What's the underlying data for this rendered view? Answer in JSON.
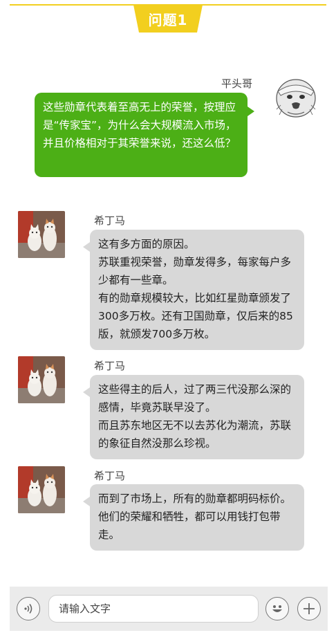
{
  "header": {
    "title": "问题1",
    "accent_color": "#f2cf1f"
  },
  "messages": [
    {
      "side": "right",
      "author": "平头哥",
      "avatar_icon": "honey-badger-avatar-icon",
      "lines": [
        "这些勋章代表着至高无上的荣誉，按理应是“传家宝”，为什么会大规模流入市场，并且价格相对于其荣誉来说，还这么低？"
      ],
      "bubble_color": "#4caf16"
    },
    {
      "side": "left",
      "author": "希丁马",
      "avatar_icon": "cats-avatar-icon",
      "lines": [
        "这有多方面的原因。",
        "苏联重视荣誉，勋章发得多，每家每户多少都有一些章。",
        "有的勋章规模较大，比如红星勋章颁发了300多万枚。还有卫国勋章，仅后来的85版，就颁发700多万枚。"
      ],
      "bubble_color": "#d8d8d8"
    },
    {
      "side": "left",
      "author": "希丁马",
      "avatar_icon": "cats-avatar-icon",
      "lines": [
        "这些得主的后人，过了两三代没那么深的感情，毕竟苏联早没了。",
        "而且苏东地区无不以去苏化为潮流，苏联的象征自然没那么珍视。"
      ],
      "bubble_color": "#d8d8d8"
    },
    {
      "side": "left",
      "author": "希丁马",
      "avatar_icon": "cats-avatar-icon",
      "lines": [
        "而到了市场上，所有的勋章都明码标价。他们的荣耀和牺牲，都可以用钱打包带走。"
      ],
      "bubble_color": "#d8d8d8"
    }
  ],
  "input_bar": {
    "placeholder": "请输入文字",
    "voice_icon": "voice-icon",
    "emoji_icon": "emoji-icon",
    "add_icon": "plus-icon"
  }
}
